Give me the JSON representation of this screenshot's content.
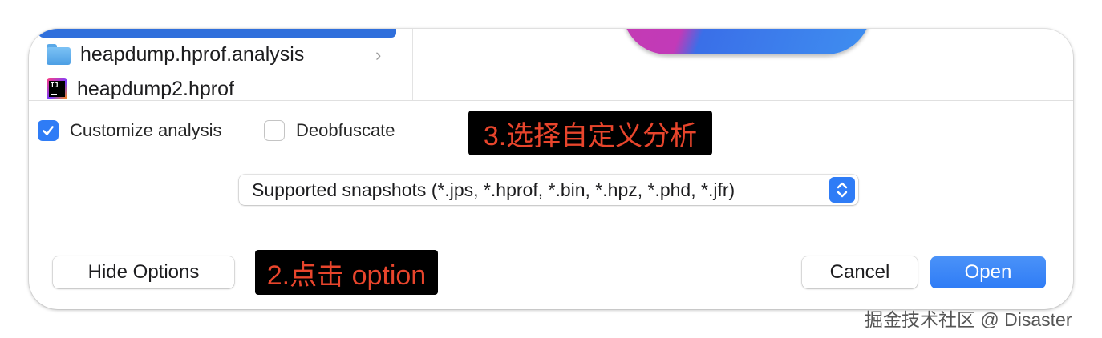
{
  "file_browser": {
    "items": [
      {
        "name": "heapdump.hprof.analysis",
        "icon": "folder-icon"
      },
      {
        "name": "heapdump2.hprof",
        "icon": "intellij-file-icon"
      }
    ],
    "ij_badge": "IJ"
  },
  "options": {
    "customize_analysis": {
      "label": "Customize analysis",
      "checked": true
    },
    "deobfuscate": {
      "label": "Deobfuscate",
      "checked": false
    },
    "file_type": {
      "selected": "Supported snapshots (*.jps, *.hprof, *.bin, *.hpz, *.phd, *.jfr)"
    }
  },
  "annotations": {
    "step3": "3.选择自定义分析",
    "step2": "2.点击 option"
  },
  "buttons": {
    "hide_options": "Hide Options",
    "cancel": "Cancel",
    "open": "Open"
  },
  "watermark": "掘金技术社区 @ Disaster",
  "colors": {
    "accent": "#2f7cf6",
    "annotation_text": "#e8452c",
    "annotation_bg": "#000000"
  }
}
